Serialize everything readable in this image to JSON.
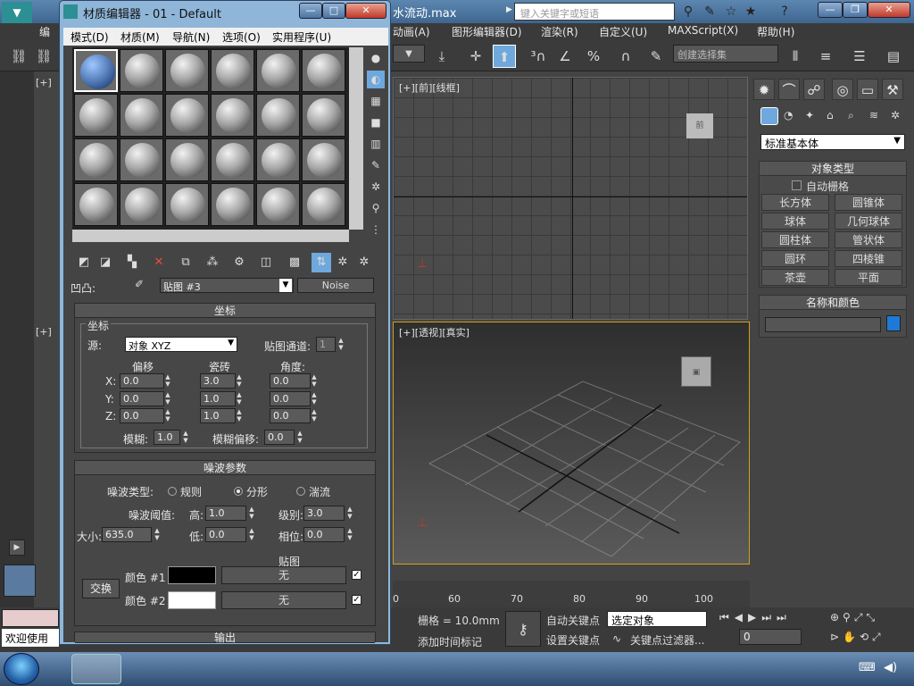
{
  "main": {
    "title_fragment": "水流动.max",
    "search_placeholder": "键入关键字或短语",
    "menus": [
      "动画(A)",
      "图形编辑器(D)",
      "渲染(R)",
      "自定义(U)",
      "MAXScript(X)",
      "帮助(H)"
    ],
    "selection_set": "创建选择集",
    "top_left_label": "[+]",
    "mid_left_label": "[+]",
    "vp_front_label": "[+][前][线框]",
    "vp_persp_label": "[+][透视][真实]"
  },
  "ruler": {
    "ticks": [
      "60",
      "70",
      "80",
      "90",
      "100"
    ],
    "zero": "0"
  },
  "command_panel": {
    "category": "标准基本体",
    "object_type_title": "对象类型",
    "auto_grid": "自动栅格",
    "buttons": [
      "长方体",
      "圆锥体",
      "球体",
      "几何球体",
      "圆柱体",
      "管状体",
      "圆环",
      "四棱锥",
      "茶壶",
      "平面"
    ],
    "name_color_title": "名称和颜色",
    "object_color": "#1e7ad6"
  },
  "bottom": {
    "welcome": "欢迎使用",
    "grid": "栅格 = 10.0mm",
    "add_time_tag": "添加时间标记",
    "auto_key": "自动关键点",
    "set_key": "设置关键点",
    "key_mode": "选定对象",
    "key_filters": "关键点过滤器...",
    "frame": "0"
  },
  "material_editor": {
    "title": "材质编辑器 - 01 - Default",
    "menus": [
      "模式(D)",
      "材质(M)",
      "导航(N)",
      "选项(O)",
      "实用程序(U)"
    ],
    "map_type_label": "凹凸:",
    "map_name": "贴图 #3",
    "map_type": "Noise",
    "coords": {
      "header": "坐标",
      "group": "坐标",
      "source_label": "源:",
      "source": "对象 XYZ",
      "channel_label": "贴图通道:",
      "channel": "1",
      "offset": "偏移",
      "tiling": "瓷砖",
      "angle": "角度:",
      "x": "X:",
      "y": "Y:",
      "z": "Z:",
      "offset_vals": [
        "0.0",
        "0.0",
        "0.0"
      ],
      "tiling_vals": [
        "3.0",
        "1.0",
        "1.0"
      ],
      "angle_vals": [
        "0.0",
        "0.0",
        "0.0"
      ],
      "blur_label": "模糊:",
      "blur": "1.0",
      "blur_offset_label": "模糊偏移:",
      "blur_offset": "0.0"
    },
    "noise": {
      "header": "噪波参数",
      "type_label": "噪波类型:",
      "types": [
        "规则",
        "分形",
        "湍流"
      ],
      "selected_type": "分形",
      "threshold_label": "噪波阈值:",
      "high_label": "高:",
      "high": "1.0",
      "levels_label": "级别:",
      "levels": "3.0",
      "size_label": "大小:",
      "size": "635.0",
      "low_label": "低:",
      "low": "0.0",
      "phase_label": "相位:",
      "phase": "0.0",
      "maps_label": "贴图",
      "swap": "交换",
      "color1_label": "颜色 #1",
      "color2_label": "颜色 #2",
      "color1": "#000000",
      "color2": "#ffffff",
      "none": "无"
    },
    "output_label": "输出"
  }
}
